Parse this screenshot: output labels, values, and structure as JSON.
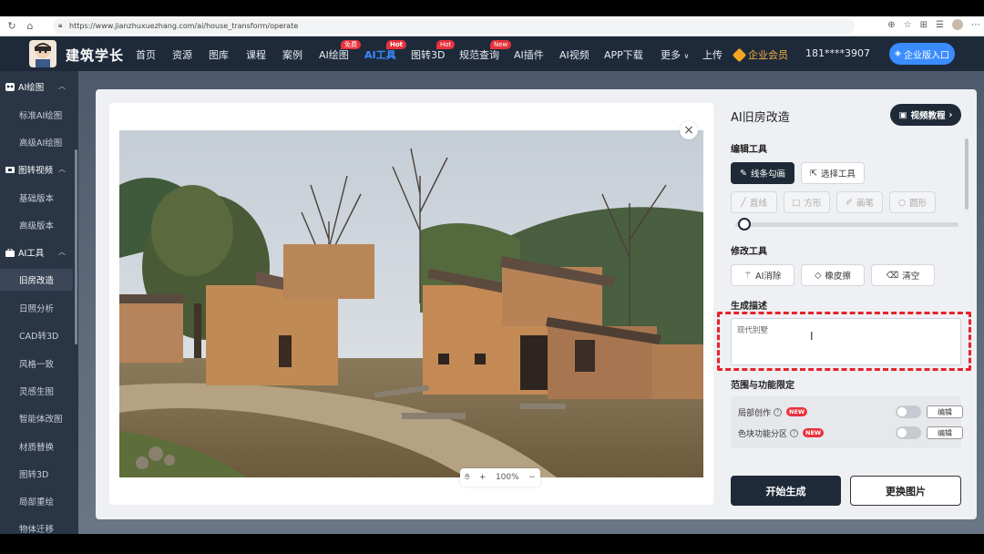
{
  "browser": {
    "url": "https://www.jianzhuxuezhang.com/ai/house_transform/operate"
  },
  "site": {
    "name": "建筑学长"
  },
  "nav": {
    "items": [
      {
        "label": "首页"
      },
      {
        "label": "资源"
      },
      {
        "label": "图库"
      },
      {
        "label": "课程"
      },
      {
        "label": "案例"
      },
      {
        "label": "AI绘图",
        "badge": "免费"
      },
      {
        "label": "AI工具",
        "badge": "Hot",
        "active": true
      },
      {
        "label": "图转3D",
        "badge": "Hot"
      },
      {
        "label": "规范查询",
        "badge": "New"
      },
      {
        "label": "AI插件"
      },
      {
        "label": "AI视频"
      },
      {
        "label": "APP下载"
      },
      {
        "label": "更多"
      },
      {
        "label": "上传"
      }
    ],
    "vip_label": "企业会员",
    "phone": "181****3907",
    "enterprise_btn": "企业版入口"
  },
  "sidebar": {
    "groups": [
      {
        "label": "AI绘图",
        "items": [
          "标准AI绘图",
          "高级AI绘图"
        ]
      },
      {
        "label": "图转视频",
        "items": [
          "基础版本",
          "高级版本"
        ]
      },
      {
        "label": "AI工具",
        "items": [
          "旧房改造",
          "日照分析",
          "CAD转3D",
          "风格一致",
          "灵感生图",
          "智能体改图",
          "材质替换",
          "图转3D",
          "局部重绘",
          "物体迁移"
        ]
      }
    ],
    "active_item": "旧房改造"
  },
  "editor": {
    "zoom": "100%",
    "title": "AI旧房改造",
    "video_btn": "视频教程",
    "edit_tools_label": "编辑工具",
    "line_sketch_btn": "线条勾画",
    "select_tool_btn": "选择工具",
    "shape_tools": [
      "直线",
      "方形",
      "画笔",
      "圆形"
    ],
    "brush_size_fraction": 0.04,
    "modify_tools_label": "修改工具",
    "modify_tools": [
      "AI消除",
      "橡皮擦",
      "清空"
    ],
    "desc_label": "生成描述",
    "desc_value": "现代别墅",
    "scope_label": "范围与功能限定",
    "scope_options": [
      {
        "label": "局部创作",
        "badge": "NEW",
        "edit": "编辑"
      },
      {
        "label": "色块功能分区",
        "badge": "NEW",
        "edit": "编辑"
      }
    ],
    "generate_btn": "开始生成",
    "replace_btn": "更换图片"
  },
  "colors": {
    "nav_bg": "#1e2a3a",
    "accent_blue": "#3b8bff",
    "dark_button": "#1f2a38",
    "badge_red": "#e8323c",
    "highlight_dash": "#e6232b"
  }
}
